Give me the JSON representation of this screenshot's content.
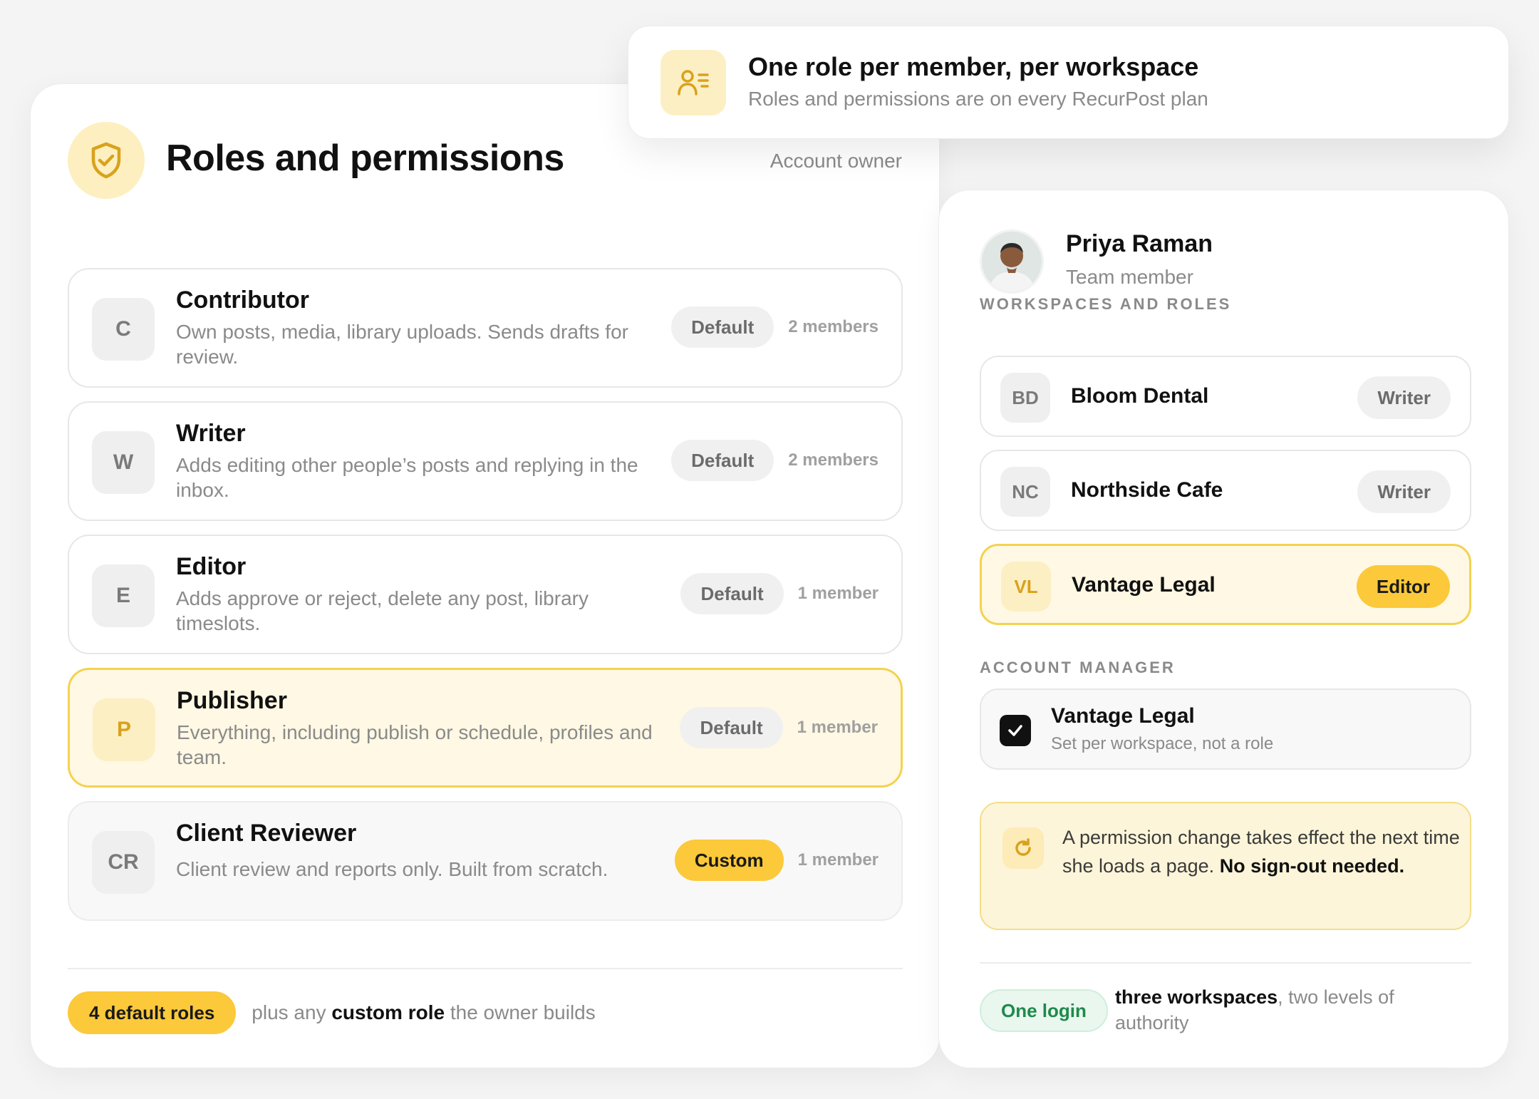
{
  "header": {
    "title": "Roles and permissions",
    "owner_label": "Account owner"
  },
  "top_card": {
    "title": "One role per member, per workspace",
    "subtitle": "Roles and permissions are on every RecurPost plan"
  },
  "roles": [
    {
      "initial": "C",
      "name": "Contributor",
      "description": "Own posts, media, library uploads. Sends drafts for review.",
      "badge": "Default",
      "count": "2 members"
    },
    {
      "initial": "W",
      "name": "Writer",
      "description": "Adds editing other people’s posts and replying in the inbox.",
      "badge": "Default",
      "count": "2 members"
    },
    {
      "initial": "E",
      "name": "Editor",
      "description": "Adds approve or reject, delete any post, library timeslots.",
      "badge": "Default",
      "count": "1 member"
    },
    {
      "initial": "P",
      "name": "Publisher",
      "description": "Everything, including publish or schedule, profiles and team.",
      "badge": "Default",
      "count": "1 member"
    },
    {
      "initial": "CR",
      "name": "Client Reviewer",
      "description": "Client review and reports only. Built from scratch.",
      "badge": "Custom",
      "count": "1 member"
    }
  ],
  "footer": {
    "pill": "4 default roles",
    "text_before": "plus any",
    "text_bold": "custom role",
    "text_after": "the owner builds"
  },
  "member": {
    "name": "Priya Raman",
    "role": "Team member"
  },
  "workspaces_label": "WORKSPACES AND ROLES",
  "workspaces": [
    {
      "initials": "BD",
      "name": "Bloom Dental",
      "role": "Writer"
    },
    {
      "initials": "NC",
      "name": "Northside Cafe",
      "role": "Writer"
    },
    {
      "initials": "VL",
      "name": "Vantage Legal",
      "role": "Editor"
    }
  ],
  "account_manager_label": "ACCOUNT MANAGER",
  "account_manager": {
    "name": "Vantage Legal",
    "subtitle": "Set per workspace, not a role",
    "checked": true
  },
  "notice": {
    "text": "A permission change takes effect the next time she loads a page.",
    "bold": "No sign-out needed."
  },
  "right_footer": {
    "pill": "One login",
    "bold": "three workspaces",
    "text": ", two levels of authority"
  },
  "icons": {
    "header": "shield-check-icon",
    "top_card": "user-list-icon",
    "checkbox": "check-icon",
    "notice": "refresh-icon"
  },
  "colors": {
    "accent": "#fbc93a",
    "accent_light": "#fef8e4",
    "accent_border": "#f4d250",
    "success": "#1f8a4c"
  }
}
